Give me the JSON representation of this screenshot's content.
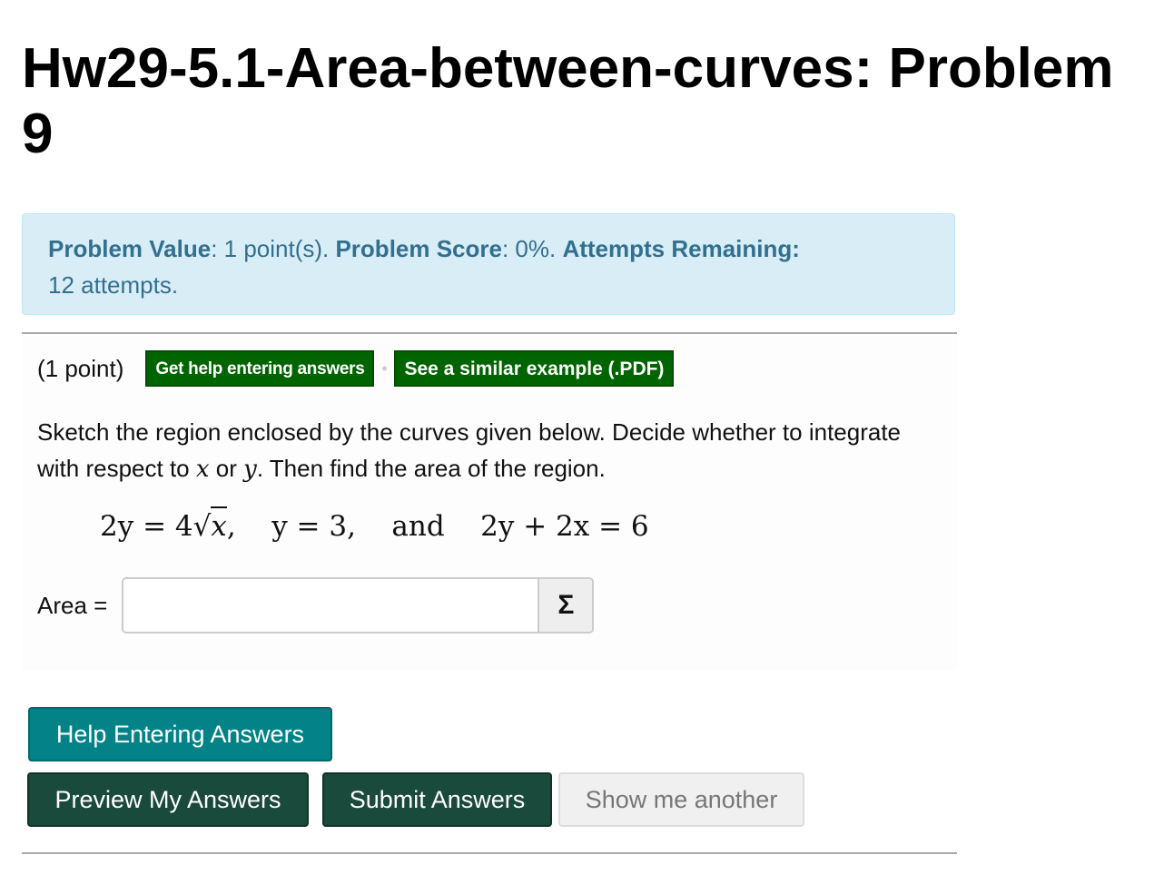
{
  "page": {
    "title": "Hw29-5.1-Area-between-curves: Problem 9"
  },
  "info": {
    "value_label": "Problem Value",
    "value_text": ": 1 point(s). ",
    "score_label": "Problem Score",
    "score_text": ": 0%. ",
    "attempts_label": "Attempts Remaining:",
    "attempts_text": " 12 attempts."
  },
  "problem": {
    "points": "(1 point)",
    "help_link": "Get help entering answers",
    "separator": "•",
    "example_link": "See a similar example (.PDF)",
    "statement_part1": "Sketch the region enclosed by the curves given below. Decide whether to integrate with respect to ",
    "var_x": "x",
    "statement_or": " or ",
    "var_y": "y",
    "statement_part2": ". Then find the area of the region.",
    "eq1_lhs": "2y = 4",
    "eq1_radicand": "x",
    "eq1_tail": ",",
    "eq2": "y = 3,",
    "eq_and": "and",
    "eq3": "2y + 2x = 6",
    "area_label": "Area =",
    "area_value": "",
    "sigma_icon": "Σ"
  },
  "buttons": {
    "help": "Help Entering Answers",
    "preview": "Preview My Answers",
    "submit": "Submit Answers",
    "another": "Show me another"
  },
  "colors": {
    "info_bg": "#d9edf7",
    "info_text": "#31708f",
    "link_green": "#006400",
    "help_teal": "#038387",
    "primary_dark": "#1a4a3b"
  }
}
